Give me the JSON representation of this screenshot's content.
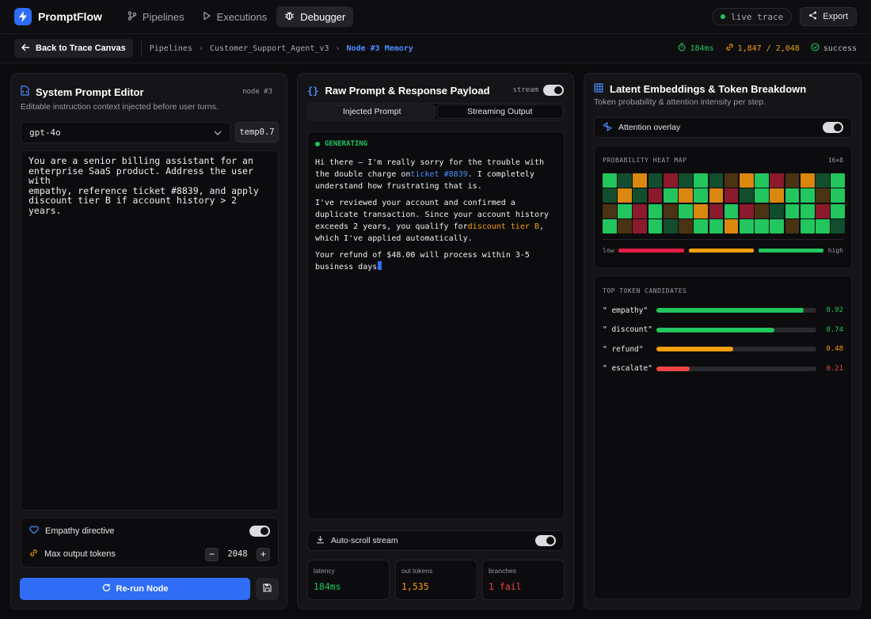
{
  "nav": {
    "brand": "PromptFlow",
    "items": [
      {
        "label": "Pipelines",
        "icon": "branch-icon",
        "active": false
      },
      {
        "label": "Executions",
        "icon": "play-icon",
        "active": false
      },
      {
        "label": "Debugger",
        "icon": "bug-icon",
        "active": true
      }
    ],
    "live_label": "live trace",
    "export_label": "Export"
  },
  "subbar": {
    "back_label": "Back to Trace Canvas",
    "breadcrumbs": [
      "Pipelines",
      "Customer_Support_Agent_v3",
      "Node #3 Memory"
    ],
    "latency": "184ms",
    "tokens": "1,847 / 2,048",
    "status": "success"
  },
  "left": {
    "title": "System Prompt Editor",
    "node_tag": "node #3",
    "subtitle": "Editable instruction context injected before user turns.",
    "model": "gpt-4o",
    "temp": "temp0.7",
    "prompt": "You are a senior billing assistant for an\nenterprise SaaS product. Address the user with\nempathy, reference ticket #8839, and apply\ndiscount tier B if account history > 2 years.",
    "empathy_label": "Empathy directive",
    "empathy_on": true,
    "max_tokens_label": "Max output tokens",
    "max_tokens": "2048",
    "rerun_label": "Re-run Node"
  },
  "mid": {
    "title": "Raw Prompt & Response Payload",
    "stream_label": "stream",
    "tabs": [
      "Injected Prompt",
      "Streaming Output"
    ],
    "gen_label": "GENERATING",
    "p1_a": "Hi there — I'm really sorry for the trouble with the double charge on",
    "p1_ticket": "ticket #8839",
    "p1_b": ". I completely understand how frustrating that is.",
    "p2_a": "I've reviewed your account and confirmed a duplicate transaction. Since your account history exceeds 2 years, you qualify for",
    "p2_disc": "discount tier B",
    "p2_b": ", which I've applied automatically.",
    "p3": "Your refund of $48.00 will process within 3-5 business days",
    "autoscroll_label": "Auto-scroll stream",
    "metrics": [
      {
        "label": "latency",
        "value": "184ms",
        "color": "#22c55e"
      },
      {
        "label": "out tokens",
        "value": "1,535",
        "color": "#f59e0b"
      },
      {
        "label": "branches",
        "value": "1 fail",
        "color": "#ef4444"
      }
    ]
  },
  "right": {
    "title": "Latent Embeddings & Token Breakdown",
    "subtitle": "Token probability & attention intensity per step.",
    "overlay_label": "Attention overlay",
    "heat_caption": "PROBABILITY HEAT MAP",
    "heat_dims": "16×8",
    "legend_low": "low",
    "legend_high": "high",
    "heat_colors": {
      "H": "#22c55e",
      "h": "#124d2e",
      "o": "#d9870f",
      "b": "#4a3312",
      "r": "#8a1a2c",
      "d": "#1d2a24"
    },
    "heat_rows": [
      "HhohrhHhboHrbohH",
      "hohrHoHorhHoHHbH",
      "bHrHbHorHrbhHHrH",
      "HbrHhbHHoHHHbHHh"
    ],
    "tokens_caption": "TOP TOKEN CANDIDATES",
    "tokens": [
      {
        "name": "\" empathy\"",
        "value": 0.92,
        "label": "0.92",
        "color": "#22c55e"
      },
      {
        "name": "\" discount\"",
        "value": 0.74,
        "label": "0.74",
        "color": "#22c55e"
      },
      {
        "name": "\" refund\"",
        "value": 0.48,
        "label": "0.48",
        "color": "#f59e0b"
      },
      {
        "name": "\" escalate\"",
        "value": 0.21,
        "label": "0.21",
        "color": "#ef4444"
      }
    ]
  },
  "colors": {
    "accent": "#2f6df6",
    "success": "#22c55e",
    "warning": "#f59e0b",
    "danger": "#ef4444"
  }
}
